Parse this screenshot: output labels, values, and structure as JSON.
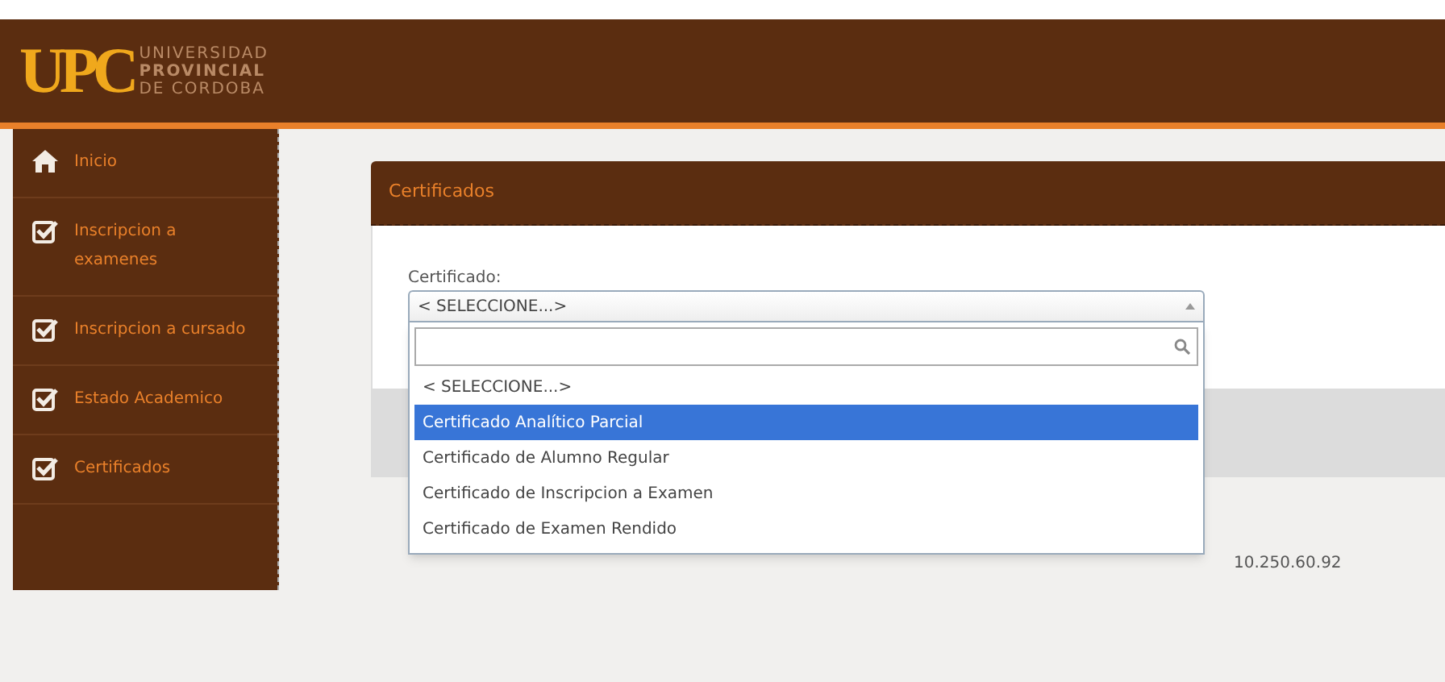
{
  "logo": {
    "mark": "UPC",
    "lines": [
      "UNIVERSIDAD",
      "PROVINCIAL",
      "DE CORDOBA"
    ]
  },
  "sidebar": {
    "items": [
      {
        "label": "Inicio",
        "kind": "home"
      },
      {
        "label": "Inscripcion a examenes",
        "kind": "check"
      },
      {
        "label": "Inscripcion a cursado",
        "kind": "check"
      },
      {
        "label": "Estado Academico",
        "kind": "check"
      },
      {
        "label": "Certificados",
        "kind": "check"
      }
    ]
  },
  "panel": {
    "title": "Certificados",
    "field_label": "Certificado:",
    "select": {
      "value": "< SELECCIONE...>",
      "expanded": true,
      "options": [
        {
          "label": "< SELECCIONE...>",
          "highlighted": false
        },
        {
          "label": "Certificado Analítico Parcial",
          "highlighted": true
        },
        {
          "label": "Certificado de Alumno Regular",
          "highlighted": false
        },
        {
          "label": "Certificado de Inscripcion a Examen",
          "highlighted": false
        },
        {
          "label": "Certificado de Examen Rendido",
          "highlighted": false
        }
      ]
    }
  },
  "footer": {
    "ip": "10.250.60.92"
  }
}
